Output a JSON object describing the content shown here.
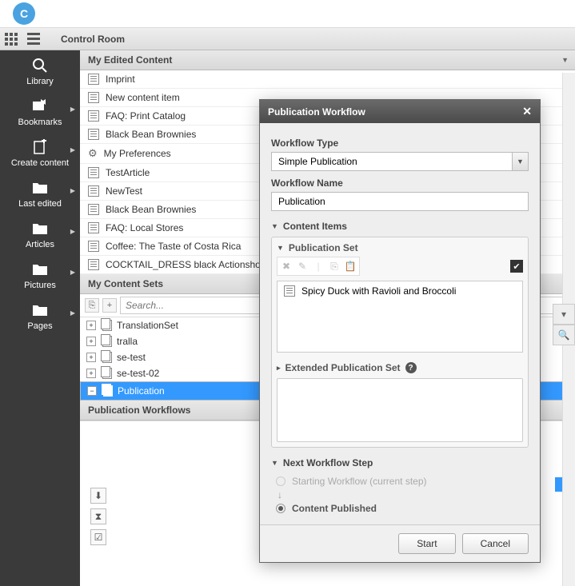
{
  "header": {
    "control_room": "Control Room"
  },
  "sidebar": {
    "items": [
      {
        "label": "Library"
      },
      {
        "label": "Bookmarks"
      },
      {
        "label": "Create content"
      },
      {
        "label": "Last edited"
      },
      {
        "label": "Articles"
      },
      {
        "label": "Pictures"
      },
      {
        "label": "Pages"
      }
    ]
  },
  "sections": {
    "edited": "My Edited Content",
    "sets": "My Content Sets",
    "workflows": "Publication Workflows"
  },
  "edited_items": [
    "Imprint",
    "New content item",
    "FAQ: Print Catalog",
    "Black Bean Brownies",
    "My Preferences",
    "TestArticle",
    "NewTest",
    "Black Bean Brownies",
    "FAQ: Local Stores",
    "Coffee: The Taste of Costa Rica",
    "COCKTAIL_DRESS black Actionshot"
  ],
  "search": {
    "placeholder": "Search..."
  },
  "content_sets": [
    {
      "label": "TranslationSet",
      "exp": "+"
    },
    {
      "label": "tralla",
      "exp": "+"
    },
    {
      "label": "se-test",
      "exp": "+"
    },
    {
      "label": "se-test-02",
      "exp": "+"
    },
    {
      "label": "Publication",
      "exp": "−",
      "sel": true
    }
  ],
  "dialog": {
    "title": "Publication Workflow",
    "wf_type_label": "Workflow Type",
    "wf_type_value": "Simple Publication",
    "wf_name_label": "Workflow Name",
    "wf_name_value": "Publication",
    "content_items": "Content Items",
    "pub_set": "Publication Set",
    "ext_pub_set": "Extended Publication Set",
    "set_item": "Spicy Duck with Ravioli and Broccoli",
    "next_step": "Next Workflow Step",
    "step1": "Starting Workflow (current step)",
    "step2": "Content Published",
    "start": "Start",
    "cancel": "Cancel"
  }
}
